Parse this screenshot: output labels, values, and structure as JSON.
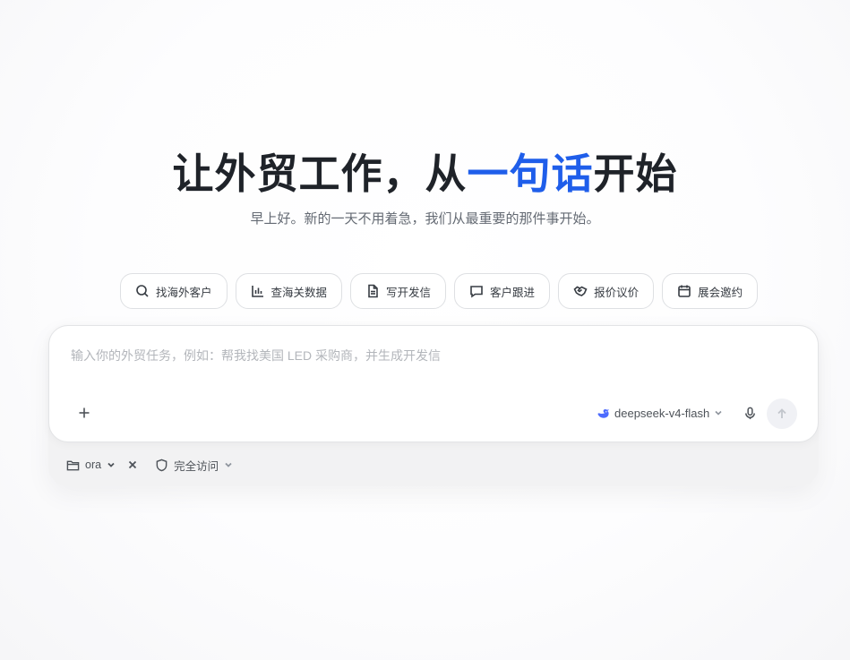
{
  "hero": {
    "title_prefix": "让外贸工作，从",
    "title_highlight": "一句话",
    "title_suffix": "开始",
    "subtitle": "早上好。新的一天不用着急，我们从最重要的那件事开始。",
    "accent_color": "#1f5eea"
  },
  "chips": [
    {
      "label": "找海外客户",
      "icon": "search-icon"
    },
    {
      "label": "查海关数据",
      "icon": "bar-chart-icon"
    },
    {
      "label": "写开发信",
      "icon": "document-icon"
    },
    {
      "label": "客户跟进",
      "icon": "chat-bubble-icon"
    },
    {
      "label": "报价议价",
      "icon": "handshake-icon"
    },
    {
      "label": "展会邀约",
      "icon": "calendar-icon"
    }
  ],
  "composer": {
    "placeholder": "输入你的外贸任务，例如：帮我找美国 LED 采购商，并生成开发信",
    "value": "",
    "model": "deepseek-v4-flash",
    "add_icon": "plus-icon",
    "mic_icon": "microphone-icon",
    "send_icon": "arrow-up-icon"
  },
  "footer": {
    "folder": "ora",
    "access": "完全访问"
  }
}
